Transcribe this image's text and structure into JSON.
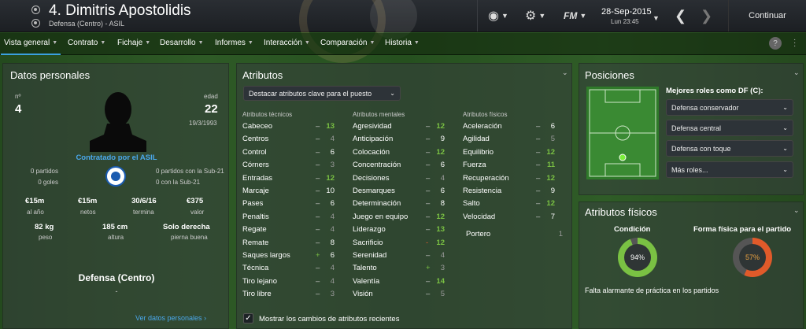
{
  "header": {
    "title": "4. Dimitris Apostolidis",
    "subtitle": "Defensa (Centro) - ASIL",
    "date": "28-Sep-2015",
    "time": "Lun 23:45",
    "fm_label": "FM",
    "continue_label": "Continuar"
  },
  "tabs": [
    "Vista general",
    "Contrato",
    "Fichaje",
    "Desarrollo",
    "Informes",
    "Interacción",
    "Comparación",
    "Historia"
  ],
  "personal": {
    "title": "Datos personales",
    "num_label": "nº",
    "num": "4",
    "age_label": "edad",
    "age": "22",
    "dob": "19/3/1993",
    "contracted": "Contratado por el ASIL",
    "left_stats": [
      "0 partidos",
      "0 goles"
    ],
    "right_stats": [
      "0 partidos con la Sub-21",
      "0 con la Sub-21"
    ],
    "row1": [
      {
        "v": "€15m",
        "l": "al año"
      },
      {
        "v": "€15m",
        "l": "netos"
      },
      {
        "v": "30/6/16",
        "l": "termina"
      },
      {
        "v": "€375",
        "l": "valor"
      }
    ],
    "row2": [
      {
        "v": "82 kg",
        "l": "peso"
      },
      {
        "v": "185 cm",
        "l": "altura"
      },
      {
        "v": "Solo derecha",
        "l": "pierna buena"
      }
    ],
    "position": "Defensa (Centro)",
    "dash": "-",
    "link": "Ver datos personales"
  },
  "attributes": {
    "title": "Atributos",
    "highlight_btn": "Destacar atributos clave para el puesto",
    "col_tech": "Atributos técnicos",
    "col_mental": "Atributos mentales",
    "col_phys": "Atributos físicos",
    "tech": [
      [
        "Cabeceo",
        "13",
        ""
      ],
      [
        "Centros",
        "4",
        ""
      ],
      [
        "Control",
        "6",
        ""
      ],
      [
        "Córners",
        "3",
        ""
      ],
      [
        "Entradas",
        "12",
        ""
      ],
      [
        "Marcaje",
        "10",
        ""
      ],
      [
        "Pases",
        "6",
        ""
      ],
      [
        "Penaltis",
        "4",
        ""
      ],
      [
        "Regate",
        "4",
        ""
      ],
      [
        "Remate",
        "8",
        ""
      ],
      [
        "Saques largos",
        "6",
        "+"
      ],
      [
        "Técnica",
        "4",
        ""
      ],
      [
        "Tiro lejano",
        "4",
        ""
      ],
      [
        "Tiro libre",
        "3",
        ""
      ]
    ],
    "mental": [
      [
        "Agresividad",
        "12",
        ""
      ],
      [
        "Anticipación",
        "9",
        ""
      ],
      [
        "Colocación",
        "12",
        ""
      ],
      [
        "Concentración",
        "6",
        ""
      ],
      [
        "Decisiones",
        "4",
        ""
      ],
      [
        "Desmarques",
        "6",
        ""
      ],
      [
        "Determinación",
        "8",
        ""
      ],
      [
        "Juego en equipo",
        "12",
        ""
      ],
      [
        "Liderazgo",
        "13",
        ""
      ],
      [
        "Sacrificio",
        "12",
        "-"
      ],
      [
        "Serenidad",
        "4",
        ""
      ],
      [
        "Talento",
        "3",
        "+"
      ],
      [
        "Valentía",
        "14",
        ""
      ],
      [
        "Visión",
        "5",
        ""
      ]
    ],
    "phys": [
      [
        "Aceleración",
        "6",
        ""
      ],
      [
        "Agilidad",
        "5",
        ""
      ],
      [
        "Equilibrio",
        "12",
        ""
      ],
      [
        "Fuerza",
        "11",
        ""
      ],
      [
        "Recuperación",
        "12",
        ""
      ],
      [
        "Resistencia",
        "9",
        ""
      ],
      [
        "Salto",
        "12",
        ""
      ],
      [
        "Velocidad",
        "7",
        ""
      ]
    ],
    "gk_label": "Portero",
    "gk_val": "1",
    "checkbox_label": "Mostrar los cambios de atributos recientes"
  },
  "positions": {
    "title": "Posiciones",
    "roles_title": "Mejores roles como DF (C):",
    "roles": [
      "Defensa conservador",
      "Defensa central",
      "Defensa con toque",
      "Más roles..."
    ]
  },
  "physical": {
    "title": "Atributos físicos",
    "condition_label": "Condición",
    "condition": "94%",
    "form_label": "Forma física para el partido",
    "form": "57%",
    "note": "Falta alarmante de práctica en los partidos"
  },
  "colors": {
    "high": "#7ac143",
    "mid": "#ffffff",
    "low": "#9a9a9a",
    "accent": "#3aa0e0",
    "orange": "#e05a2a"
  }
}
